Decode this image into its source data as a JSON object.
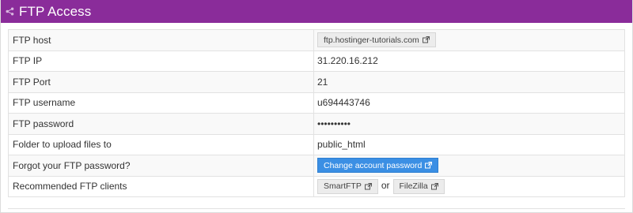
{
  "header": {
    "title": "FTP Access",
    "icon": "share-icon",
    "color": "#8a2c9a"
  },
  "rows": {
    "host": {
      "label": "FTP host",
      "value": "ftp.hostinger-tutorials.com"
    },
    "ip": {
      "label": "FTP IP",
      "value": "31.220.16.212"
    },
    "port": {
      "label": "FTP Port",
      "value": "21"
    },
    "username": {
      "label": "FTP username",
      "value": "u694443746"
    },
    "password": {
      "label": "FTP password",
      "value": "••••••••••"
    },
    "folder": {
      "label": "Folder to upload files to",
      "value": "public_html"
    },
    "forgot": {
      "label": "Forgot your FTP password?",
      "button": "Change account password"
    },
    "clients": {
      "label": "Recommended FTP clients",
      "client1": "SmartFTP",
      "separator": "or",
      "client2": "FileZilla"
    }
  },
  "colors": {
    "primary_button": "#3b8fe4",
    "header": "#8a2c9a"
  }
}
